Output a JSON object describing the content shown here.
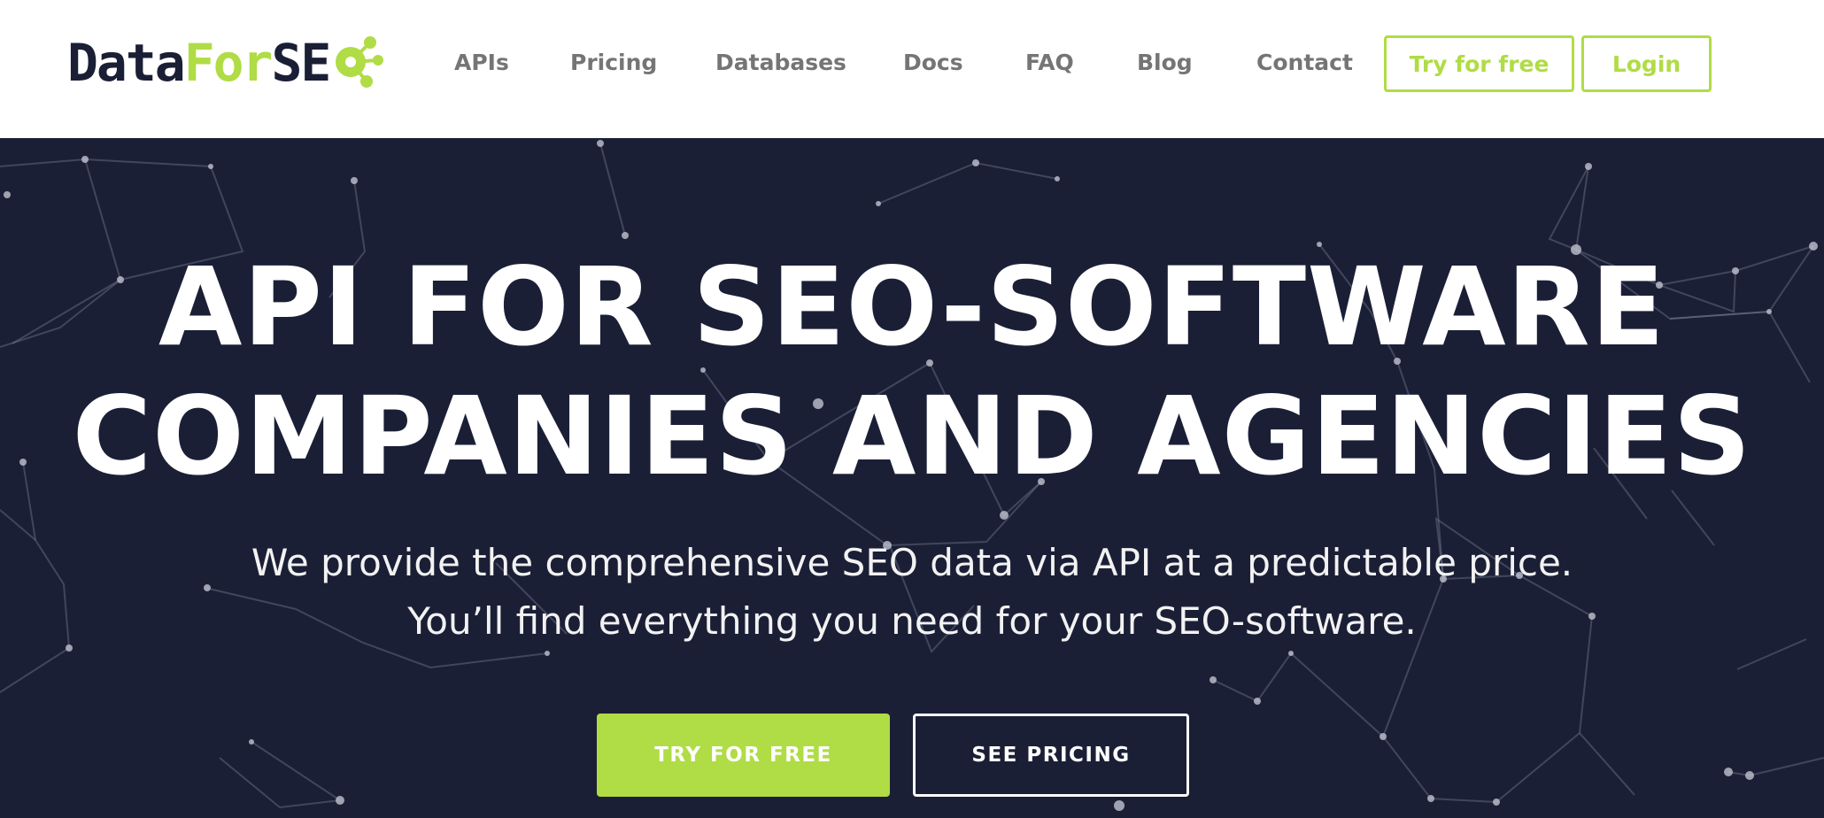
{
  "logo": {
    "part_data": "Data",
    "part_for": "For",
    "part_se": "SE",
    "icon": "molecule-icon"
  },
  "nav": {
    "items": [
      {
        "label": "APIs"
      },
      {
        "label": "Pricing"
      },
      {
        "label": "Databases"
      },
      {
        "label": "Docs"
      },
      {
        "label": "FAQ"
      },
      {
        "label": "Blog"
      },
      {
        "label": "Contact"
      }
    ],
    "try_label": "Try for free",
    "login_label": "Login"
  },
  "hero": {
    "title_line1": "API FOR SEO-SOFTWARE",
    "title_line2": "COMPANIES AND AGENCIES",
    "subtitle_line1": "We provide the comprehensive SEO data via API at a predictable price.",
    "subtitle_line2": "You’ll find everything you need for your SEO-software.",
    "cta_primary": "TRY FOR FREE",
    "cta_secondary": "SEE PRICING"
  },
  "colors": {
    "brand_green": "#b0dc45",
    "navy": "#1b1f36",
    "nav_gray": "#757575"
  }
}
